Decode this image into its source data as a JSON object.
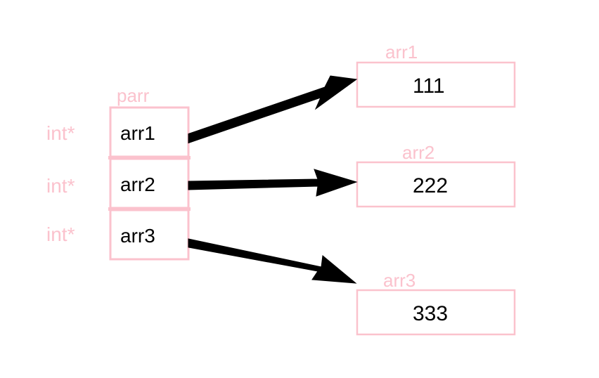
{
  "diagram": {
    "pointerArray": {
      "name": "parr",
      "element_type": "int*",
      "cells": [
        {
          "label": "arr1",
          "points_to": "arr1"
        },
        {
          "label": "arr2",
          "points_to": "arr2"
        },
        {
          "label": "arr3",
          "points_to": "arr3"
        }
      ]
    },
    "targets": [
      {
        "name": "arr1",
        "value": "111"
      },
      {
        "name": "arr2",
        "value": "222"
      },
      {
        "name": "arr3",
        "value": "333"
      }
    ],
    "colors": {
      "pink": "#fbc2cd",
      "black": "#000000",
      "background": "#ffffff"
    }
  }
}
